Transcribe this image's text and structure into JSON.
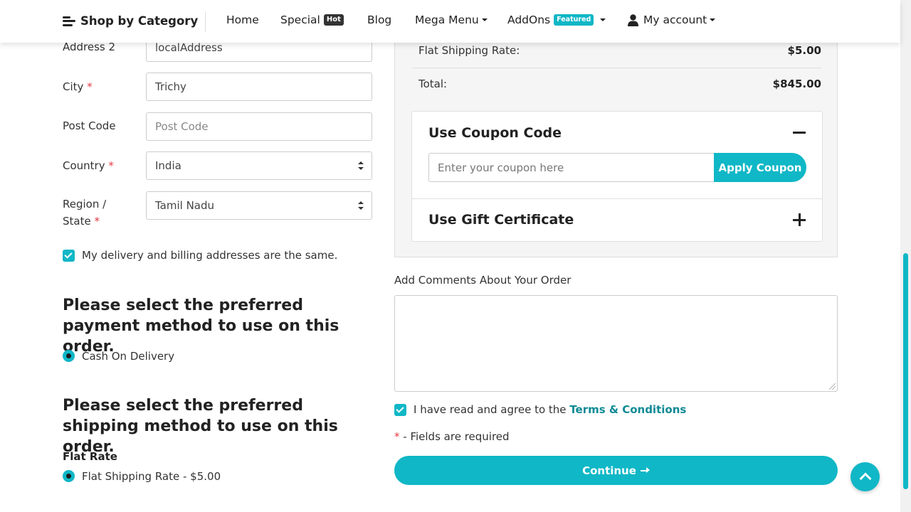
{
  "nav": {
    "category": "Shop by Category",
    "items": [
      {
        "label": "Home"
      },
      {
        "label": "Special",
        "badge": "Hot"
      },
      {
        "label": "Blog"
      },
      {
        "label": "Mega Menu"
      },
      {
        "label": "AddOns",
        "badge": "Featured"
      },
      {
        "label": "My account"
      }
    ]
  },
  "form": {
    "address2": {
      "label": "Address 2",
      "value": "localAddress"
    },
    "city": {
      "label": "City",
      "value": "Trichy"
    },
    "postcode": {
      "label": "Post Code",
      "placeholder": "Post Code"
    },
    "country": {
      "label": "Country",
      "value": "India"
    },
    "region": {
      "label_line1": "Region /",
      "label_line2": "State",
      "value": "Tamil Nadu"
    },
    "same_address": "My delivery and billing addresses are the same.",
    "required_mark": "*"
  },
  "payment": {
    "heading": "Please select the preferred payment method to use on this order.",
    "option": "Cash On Delivery"
  },
  "shipping": {
    "heading": "Please select the preferred shipping method to use on this order.",
    "group": "Flat Rate",
    "option": "Flat Shipping Rate - $5.00"
  },
  "totals": {
    "shipping_label": "Flat Shipping Rate:",
    "shipping_value": "$5.00",
    "total_label": "Total:",
    "total_value": "$845.00"
  },
  "coupon": {
    "title": "Use Coupon Code",
    "placeholder": "Enter your coupon here",
    "button": "Apply Coupon",
    "gift_title": "Use Gift Certificate"
  },
  "comments": {
    "label": "Add Comments About Your Order"
  },
  "agree": {
    "text": "I have read and agree to the",
    "link": "Terms & Conditions"
  },
  "required_note": "- Fields are required",
  "continue_label": "Continue",
  "colors": {
    "accent": "#10b7c6",
    "required": "#e53945"
  }
}
